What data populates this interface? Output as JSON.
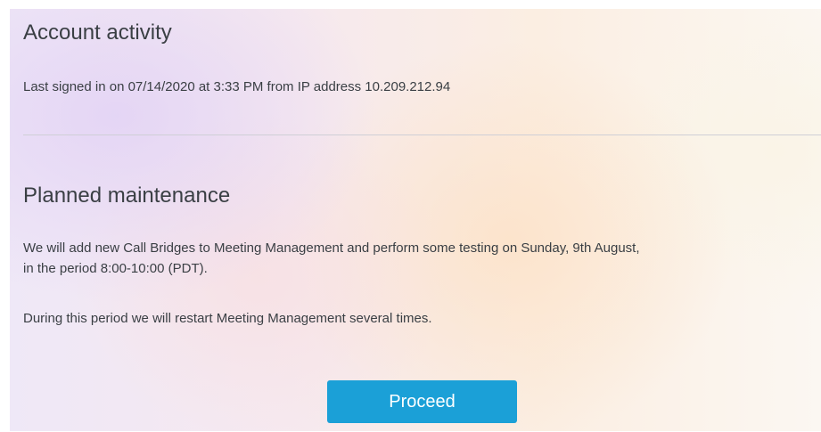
{
  "account_activity": {
    "title": "Account activity",
    "last_signed_in": "Last signed in on 07/14/2020 at 3:33 PM from IP address 10.209.212.94"
  },
  "maintenance": {
    "title": "Planned maintenance",
    "paragraph_1_line_1": "We will add new Call Bridges to Meeting Management and perform some testing on Sunday, 9th August,",
    "paragraph_1_line_2": "in the period 8:00-10:00 (PDT).",
    "paragraph_2": "During this period we will restart Meeting Management several times."
  },
  "actions": {
    "proceed_label": "Proceed"
  },
  "colors": {
    "primary_button": "#1ba0d7",
    "text": "#3a3f44",
    "divider": "#cfcfd6"
  }
}
